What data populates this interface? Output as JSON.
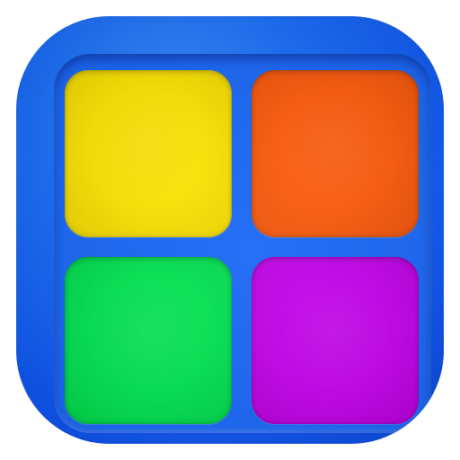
{
  "tiles": [
    {
      "id": "yellow",
      "color": "#ffe600"
    },
    {
      "id": "orange",
      "color": "#ff5a0a"
    },
    {
      "id": "green",
      "color": "#00e550"
    },
    {
      "id": "purple",
      "color": "#c400eb"
    }
  ],
  "colors": {
    "icon_background": "#1b6ef8",
    "recess": "#1b68f6",
    "page_background": "#ffffff"
  }
}
